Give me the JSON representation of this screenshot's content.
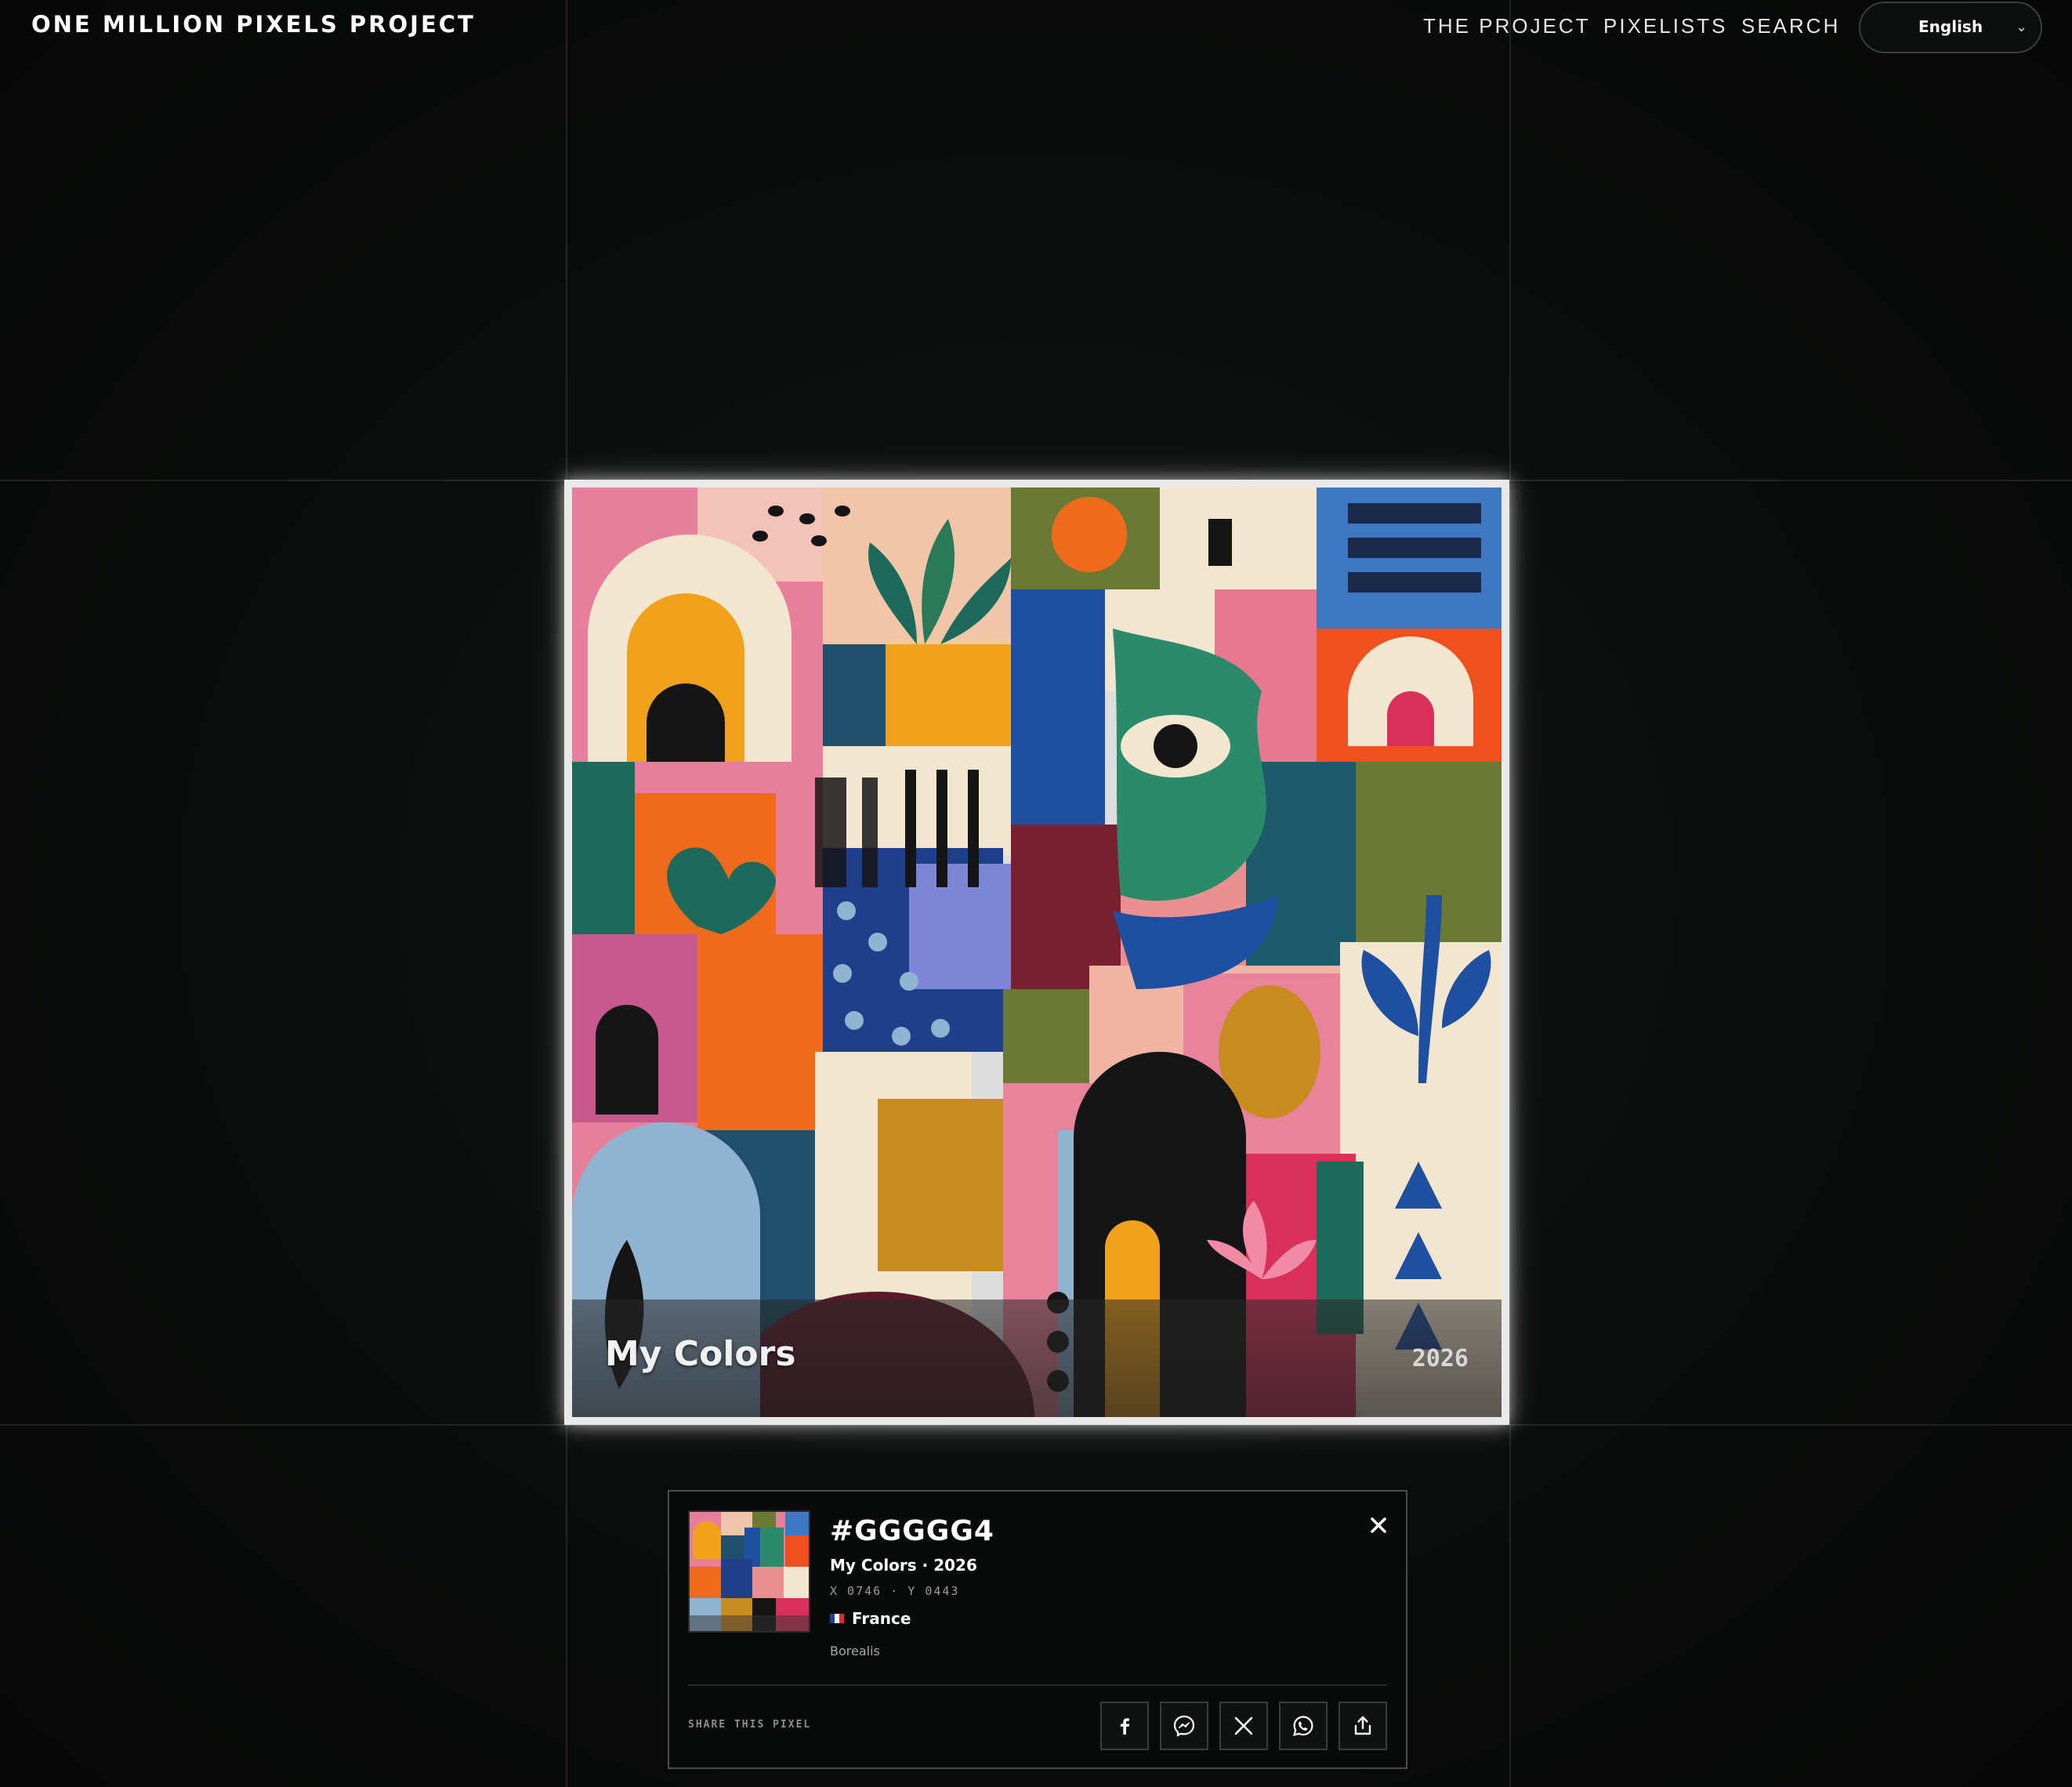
{
  "header": {
    "brand": "ONE MILLION PIXELS PROJECT",
    "nav": [
      {
        "label": "THE PROJECT"
      },
      {
        "label": "PIXELISTS"
      },
      {
        "label": "SEARCH"
      }
    ],
    "language": {
      "selected": "English",
      "icon": "chevron-down-icon"
    }
  },
  "artwork": {
    "title": "My Colors",
    "year": "2026"
  },
  "pixel_card": {
    "hex": "#GGGGG4",
    "subtitle": "My Colors · 2026",
    "coords": "X 0746 · Y 0443",
    "country": "France",
    "flag_icon": "france-flag-icon",
    "collection": "Borealis",
    "close_icon": "close-icon",
    "share_label": "SHARE THIS PIXEL",
    "share_buttons": [
      {
        "icon": "facebook-icon"
      },
      {
        "icon": "messenger-icon"
      },
      {
        "icon": "x-twitter-icon"
      },
      {
        "icon": "whatsapp-icon"
      },
      {
        "icon": "share-upload-icon"
      }
    ]
  },
  "colors": {
    "background": "#0b0d0c",
    "card_border": "#4a4d4c",
    "frame_border": "#e9e9e9",
    "palette": [
      "#e86f8a",
      "#f0a21a",
      "#1f4fa0",
      "#f06a1e",
      "#1e6a5a",
      "#f3e6cf",
      "#7a1f2e",
      "#151515"
    ]
  }
}
